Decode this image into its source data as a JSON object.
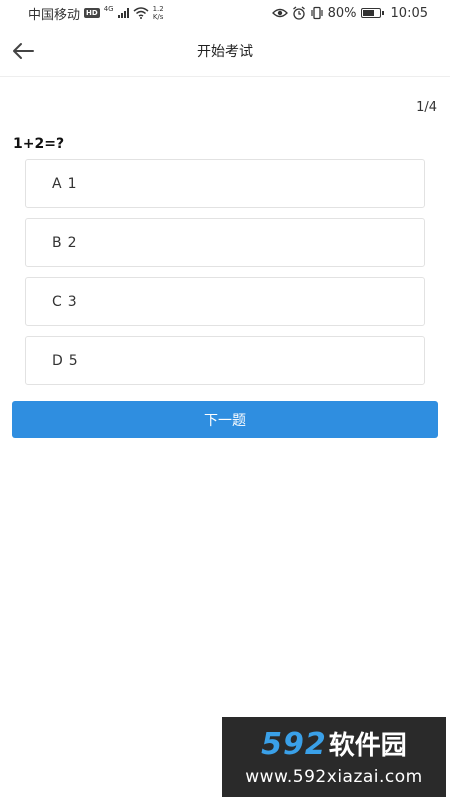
{
  "status_bar": {
    "carrier": "中国移动",
    "hd_badge": "HD",
    "network_type": "4G",
    "speed_value": "1.2",
    "speed_unit": "K/s",
    "battery_percent": "80%",
    "battery_level": 0.8,
    "time": "10:05"
  },
  "nav": {
    "title": "开始考试",
    "back_icon": "arrow-left-icon"
  },
  "progress": "1/4",
  "question": "1+2=?",
  "options": [
    {
      "letter": "A",
      "text": "1"
    },
    {
      "letter": "B",
      "text": "2"
    },
    {
      "letter": "C",
      "text": "3"
    },
    {
      "letter": "D",
      "text": "5"
    }
  ],
  "next_button": "下一题",
  "watermark": {
    "number": "592",
    "name": "软件园",
    "url": "www.592xiazai.com"
  },
  "colors": {
    "primary": "#2f8ee0",
    "option_border": "#e2e2e2",
    "watermark_bg": "#2a2a2a",
    "watermark_accent": "#3aa0e8"
  }
}
